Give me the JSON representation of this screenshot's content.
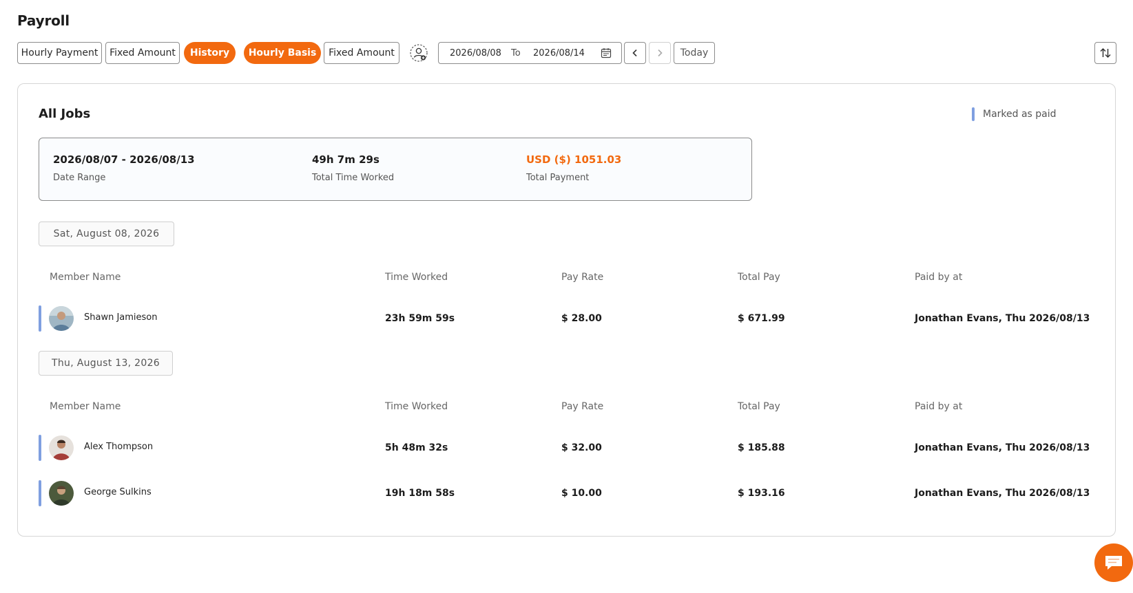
{
  "page_title": "Payroll",
  "toolbar": {
    "tabs": [
      {
        "label": "Hourly Payment",
        "active": false
      },
      {
        "label": "Fixed Amount",
        "active": false
      },
      {
        "label": "History",
        "active": true
      }
    ],
    "subtabs": [
      {
        "label": "Hourly Basis",
        "active": true
      },
      {
        "label": "Fixed Amount",
        "active": false
      }
    ],
    "member_filter_icon": "member-filter-icon",
    "date_from": "2026/08/08",
    "to_label": "To",
    "date_to": "2026/08/14",
    "today_label": "Today",
    "accent_color": "#f2690f"
  },
  "card": {
    "title": "All Jobs",
    "legend_label": "Marked as paid",
    "legend_color": "#7f9fe0",
    "summary": {
      "date_range_value": "2026/08/07 - 2026/08/13",
      "date_range_label": "Date Range",
      "time_value": "49h 7m 29s",
      "time_label": "Total Time Worked",
      "payment_value": "USD ($) 1051.03",
      "payment_label": "Total Payment"
    },
    "columns": [
      "Member Name",
      "Time Worked",
      "Pay Rate",
      "Total Pay",
      "Paid by at"
    ],
    "groups": [
      {
        "date": "Sat, August 08, 2026",
        "rows": [
          {
            "name": "Shawn Jamieson",
            "time": "23h 59m 59s",
            "rate": "$ 28.00",
            "total": "$ 671.99",
            "paid_by": "Jonathan Evans, Thu 2026/08/13"
          }
        ]
      },
      {
        "date": "Thu, August 13, 2026",
        "rows": [
          {
            "name": "Alex Thompson",
            "time": "5h 48m 32s",
            "rate": "$ 32.00",
            "total": "$ 185.88",
            "paid_by": "Jonathan Evans, Thu 2026/08/13"
          },
          {
            "name": "George Sulkins",
            "time": "19h 18m 58s",
            "rate": "$ 10.00",
            "total": "$ 193.16",
            "paid_by": "Jonathan Evans, Thu 2026/08/13"
          }
        ]
      }
    ]
  }
}
